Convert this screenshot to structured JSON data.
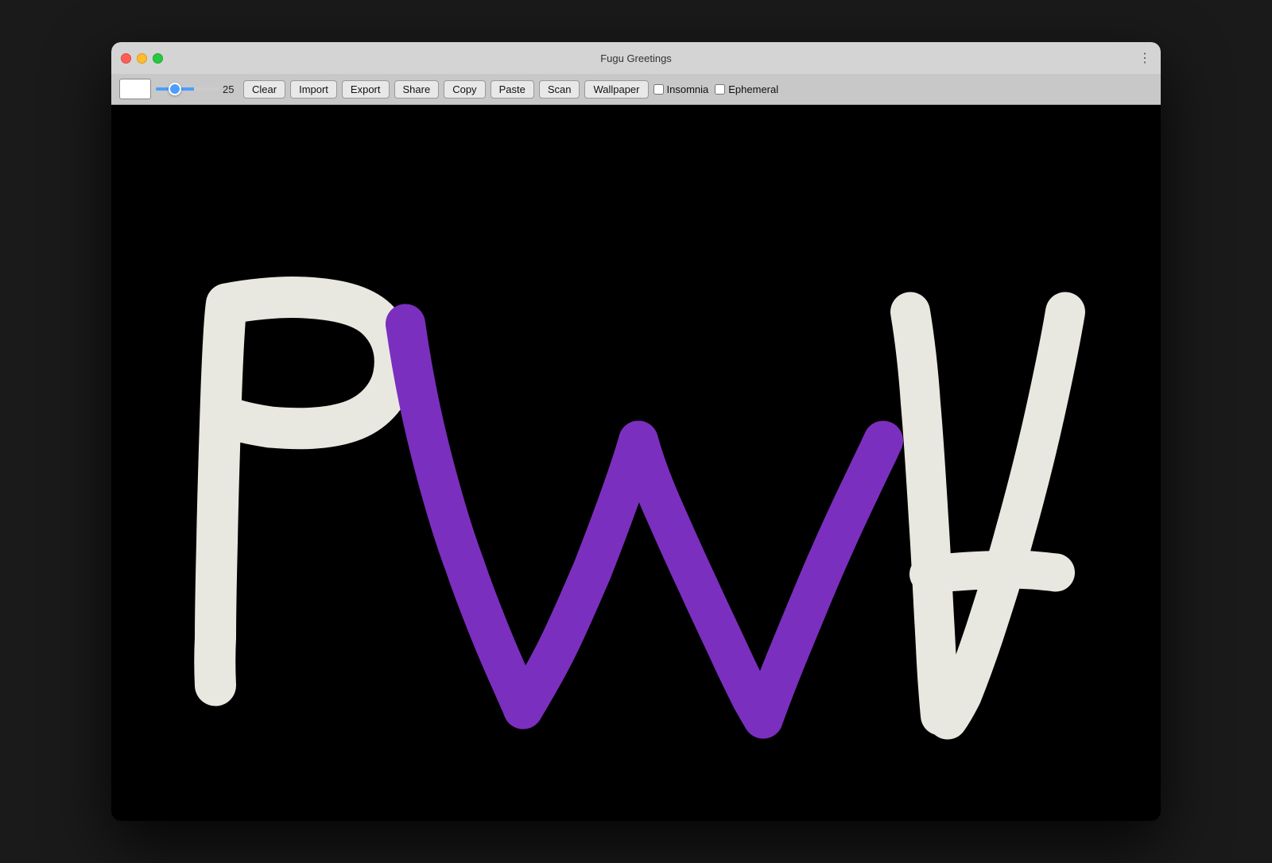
{
  "window": {
    "title": "Fugu Greetings",
    "traffic_lights": {
      "close_label": "close",
      "minimize_label": "minimize",
      "maximize_label": "maximize"
    }
  },
  "toolbar": {
    "color_swatch_value": "#ffffff",
    "slider_value": "25",
    "buttons": {
      "clear": "Clear",
      "import": "Import",
      "export": "Export",
      "share": "Share",
      "copy": "Copy",
      "paste": "Paste",
      "scan": "Scan",
      "wallpaper": "Wallpaper"
    },
    "checkboxes": {
      "insomnia": "Insomnia",
      "ephemeral": "Ephemeral"
    },
    "more_icon": "⋮"
  },
  "canvas": {
    "background": "#000000",
    "description": "PWA drawing"
  }
}
